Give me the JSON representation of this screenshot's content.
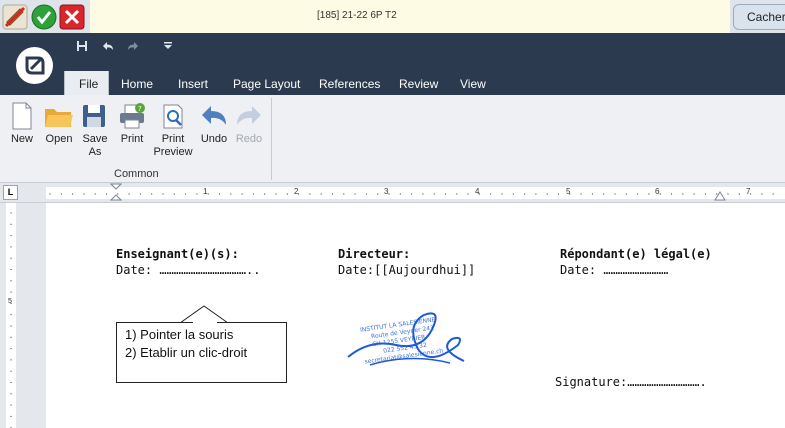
{
  "titlebar": {
    "window_title": "[185] 21-22 6P T2",
    "hide_button": "Cacher"
  },
  "quick_access": {
    "items": [
      "save-icon",
      "undo-icon",
      "redo-icon",
      "dropdown-icon"
    ]
  },
  "menu": {
    "tabs": [
      "File",
      "Home",
      "Insert",
      "Page Layout",
      "References",
      "Review",
      "View"
    ],
    "active_tab": "File"
  },
  "ribbon": {
    "buttons": [
      {
        "label": "New",
        "icon": "new-document-icon",
        "enabled": true
      },
      {
        "label": "Open",
        "icon": "open-folder-icon",
        "enabled": true
      },
      {
        "label": "Save\nAs",
        "icon": "save-as-icon",
        "enabled": true
      },
      {
        "label": "Print",
        "icon": "printer-icon",
        "enabled": true
      },
      {
        "label": "Print\nPreview",
        "icon": "print-preview-icon",
        "enabled": true
      },
      {
        "label": "Undo",
        "icon": "undo-icon",
        "enabled": true
      },
      {
        "label": "Redo",
        "icon": "redo-icon",
        "enabled": false
      }
    ],
    "group_label": "Common"
  },
  "ruler": {
    "numbers": [
      "1",
      "2",
      "3",
      "4",
      "5",
      "6",
      "7"
    ],
    "vertical_numbers": [
      "5"
    ]
  },
  "document": {
    "teacher_heading": "Enseignant(e)(s):",
    "teacher_date": "Date: ………………………………..",
    "director_heading": "Directeur:",
    "director_date": "Date:[[Aujourdhui]]",
    "guardian_heading": "Répondant(e) légal(e)",
    "guardian_date": "Date: ………………………",
    "signature": "Signature:…………………………."
  },
  "stamp": {
    "lines": [
      "INSTITUT LA SALESIENNE",
      "Route de Veyrier 243",
      "CH-1255 VEYRIER",
      "022 552 43 32",
      "secretariat@salesienne.ch"
    ]
  },
  "callout": {
    "line1": "1) Pointer la souris",
    "line2": "2) Etablir un clic-droit"
  },
  "colors": {
    "dark_bar": "#2b3a4e",
    "ribbon_bg": "#eef0f4",
    "stamp_blue": "#2a6fd6"
  }
}
